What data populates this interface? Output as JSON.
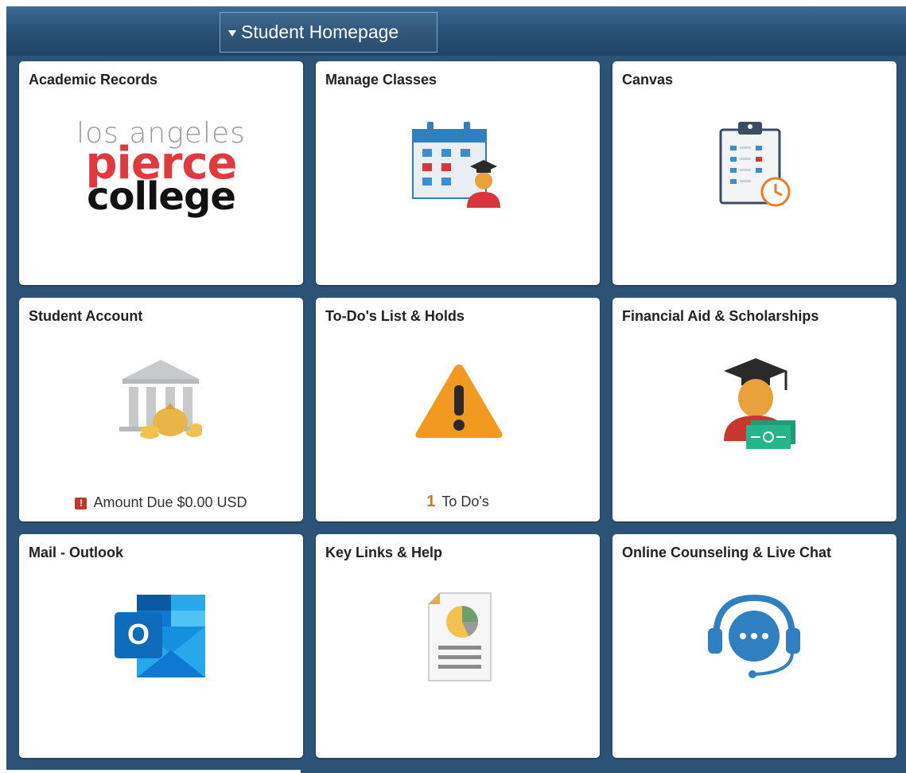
{
  "header": {
    "selector_label": "Student Homepage"
  },
  "tiles": [
    {
      "title": "Academic Records",
      "icon": "pierce-college-logo"
    },
    {
      "title": "Manage Classes",
      "icon": "calendar-student-icon"
    },
    {
      "title": "Canvas",
      "icon": "clipboard-clock-icon"
    },
    {
      "title": "Student Account",
      "icon": "bank-money-icon",
      "footer": {
        "badge": "!",
        "text": "Amount Due $0.00 USD"
      }
    },
    {
      "title": "To-Do's List & Holds",
      "icon": "warning-icon",
      "footer": {
        "count": "1",
        "text": "To Do's"
      }
    },
    {
      "title": "Financial Aid & Scholarships",
      "icon": "graduate-money-icon"
    },
    {
      "title": "Mail - Outlook",
      "icon": "outlook-icon"
    },
    {
      "title": "Key Links & Help",
      "icon": "document-chart-icon"
    },
    {
      "title": "Online Counseling & Live Chat",
      "icon": "headset-chat-icon"
    }
  ],
  "logo": {
    "line1": "los angeles",
    "line2": "pierce",
    "line3": "college"
  },
  "outlook_letter": "O",
  "colors": {
    "header_top": "#3f6a93",
    "header_bottom": "#1f4466",
    "grid_bg": "#2c5275",
    "pierce_red": "#e03a3e",
    "warning_orange": "#f19a1f"
  }
}
